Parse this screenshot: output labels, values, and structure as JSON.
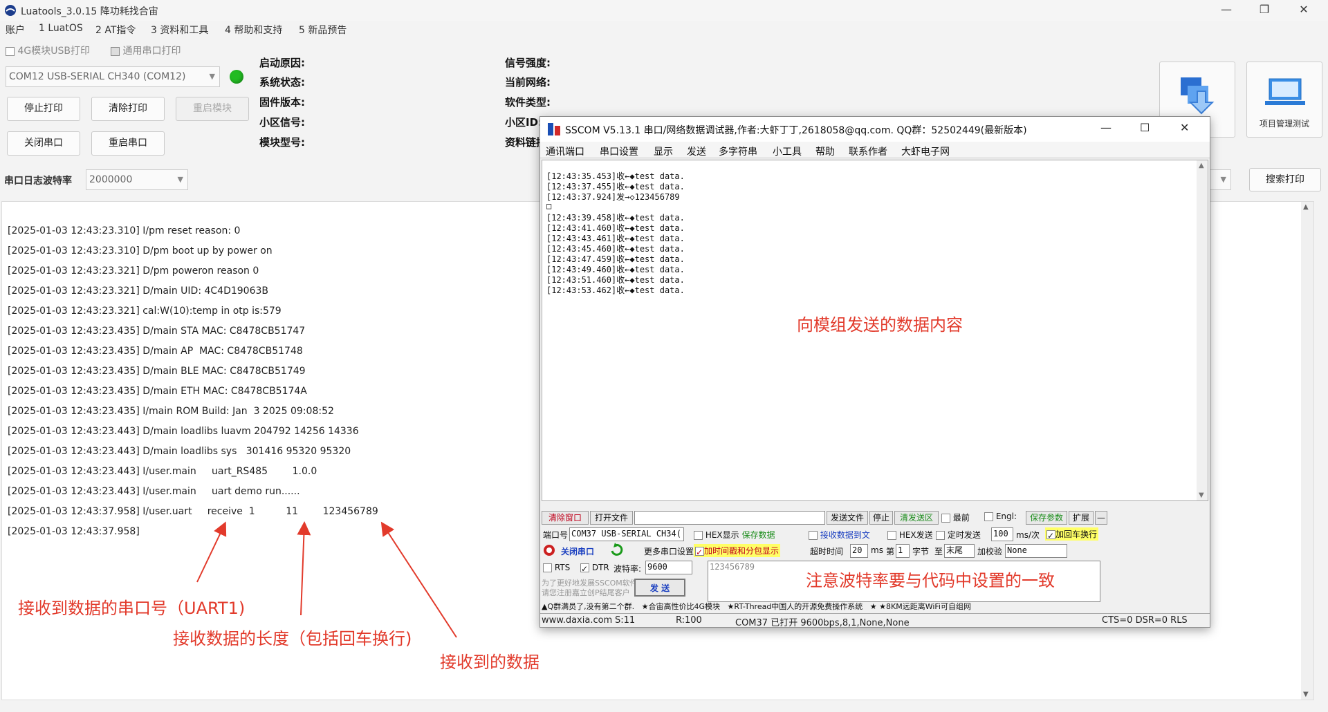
{
  "app": {
    "title": "Luatools_3.0.15 降功耗找合宙",
    "win_min": "—",
    "win_max": "❐",
    "win_close": "✕"
  },
  "menu": [
    "账户",
    "1 LuatOS",
    "2 AT指令",
    "3 资料和工具",
    "4 帮助和支持",
    "5 新品预告"
  ],
  "options": {
    "usb_print": "4G模块USB打印",
    "serial_print": "通用串口打印"
  },
  "port": {
    "selected": "COM12 USB-SERIAL CH340 (COM12)",
    "status_color": "#22bb22"
  },
  "buttons": {
    "stop_print": "停止打印",
    "clear_print": "清除打印",
    "restart_module": "重启模块",
    "close_port": "关闭串口",
    "restart_port": "重启串口",
    "search_print": "搜索打印",
    "download": "下载固件",
    "project_test": "项目管理测试"
  },
  "info": {
    "boot_reason": "启动原因:",
    "sys_status": "系统状态:",
    "firmware": "固件版本:",
    "cell_signal": "小区信号:",
    "module_type": "模块型号:",
    "signal_strength": "信号强度:",
    "network": "当前网络:",
    "software_type": "软件类型:",
    "cell_id": "小区ID:",
    "res_link": "资料链接:"
  },
  "baud": {
    "label": "串口日志波特率",
    "value": "2000000"
  },
  "log": [
    "[2025-01-03 12:43:23.310] I/pm reset reason: 0",
    "[2025-01-03 12:43:23.310] D/pm boot up by power on",
    "[2025-01-03 12:43:23.321] D/pm poweron reason 0",
    "[2025-01-03 12:43:23.321] D/main UID: 4C4D19063B",
    "[2025-01-03 12:43:23.321] cal:W(10):temp in otp is:579",
    "[2025-01-03 12:43:23.435] D/main STA MAC: C8478CB51747",
    "[2025-01-03 12:43:23.435] D/main AP  MAC: C8478CB51748",
    "[2025-01-03 12:43:23.435] D/main BLE MAC: C8478CB51749",
    "[2025-01-03 12:43:23.435] D/main ETH MAC: C8478CB5174A",
    "[2025-01-03 12:43:23.435] I/main ROM Build: Jan  3 2025 09:08:52",
    "[2025-01-03 12:43:23.443] D/main loadlibs luavm 204792 14256 14336",
    "[2025-01-03 12:43:23.443] D/main loadlibs sys   301416 95320 95320",
    "[2025-01-03 12:43:23.443] I/user.main     uart_RS485        1.0.0",
    "[2025-01-03 12:43:23.443] I/user.main     uart demo run......",
    "[2025-01-03 12:43:37.958] I/user.uart     receive  1          11        123456789",
    "[2025-01-03 12:43:37.958]"
  ],
  "annotations": {
    "port_num": "接收到数据的串口号（UART1)",
    "data_len": "接收数据的长度（包括回车换行)",
    "data_recv": "接收到的数据",
    "send_content": "向模组发送的数据内容",
    "baud_note": "注意波特率要与代码中设置的一致"
  },
  "sscom": {
    "title": "SSCOM V5.13.1 串口/网络数据调试器,作者:大虾丁丁,2618058@qq.com. QQ群：52502449(最新版本)",
    "menu": [
      "通讯端口",
      "串口设置",
      "显示",
      "发送",
      "多字符串",
      "小工具",
      "帮助",
      "联系作者",
      "大虾电子网"
    ],
    "term": [
      "[12:43:35.453]收←◆test data.",
      "[12:43:37.455]收←◆test data.",
      "[12:43:37.924]发→◇123456789",
      "□",
      "[12:43:39.458]收←◆test data.",
      "[12:43:41.460]收←◆test data.",
      "[12:43:43.461]收←◆test data.",
      "[12:43:45.460]收←◆test data.",
      "[12:43:47.459]收←◆test data.",
      "[12:43:49.460]收←◆test data.",
      "[12:43:51.460]收←◆test data.",
      "[12:43:53.462]收←◆test data."
    ],
    "clear_win": "清除窗口",
    "open_file": "打开文件",
    "send_file": "发送文件",
    "stop": "停止",
    "clear_send": "清发送区",
    "topmost": "最前",
    "english": "Engl:",
    "save_params": "保存参数",
    "expand": "扩展",
    "port_label": "端口号",
    "port_value": "COM37 USB-SERIAL CH34(",
    "hex_show": "HEX显示",
    "save_data": "保存数据",
    "recv_to_file": "接收数据到文",
    "hex_send": "HEX发送",
    "timed_send": "定时发送",
    "interval": "100",
    "interval_unit": "ms/次",
    "add_crlf": "加回车换行",
    "close_port": "关闭串口",
    "more_settings": "更多串口设置",
    "add_timestamp": "加时间戳和分包显示",
    "timeout": "超时时间",
    "timeout_val": "20",
    "ms": "ms",
    "nth": "第",
    "nth_val": "1",
    "byte": "字节",
    "to": "至",
    "end": "末尾",
    "checksum": "加校验",
    "checksum_val": "None",
    "rts": "RTS",
    "dtr": "DTR",
    "baud_label": "波特率:",
    "baud_value": "9600",
    "send_text": "123456789",
    "promo": "为了更好地发展SSCOM软件\n请您注册嘉立创P结尾客户",
    "send_btn": "发 送",
    "ticker": "▲Q群满员了,没有第二个群.   ★合宙高性价比4G模块   ★RT-Thread中国人的开源免费操作系统   ★ ★8KM远距离WiFi可自组网",
    "status": {
      "site": "www.daxia.com",
      "s": "S:11",
      "r": "R:100",
      "port": "COM37 已打开  9600bps,8,1,None,None",
      "lines": "CTS=0 DSR=0 RLS"
    }
  }
}
